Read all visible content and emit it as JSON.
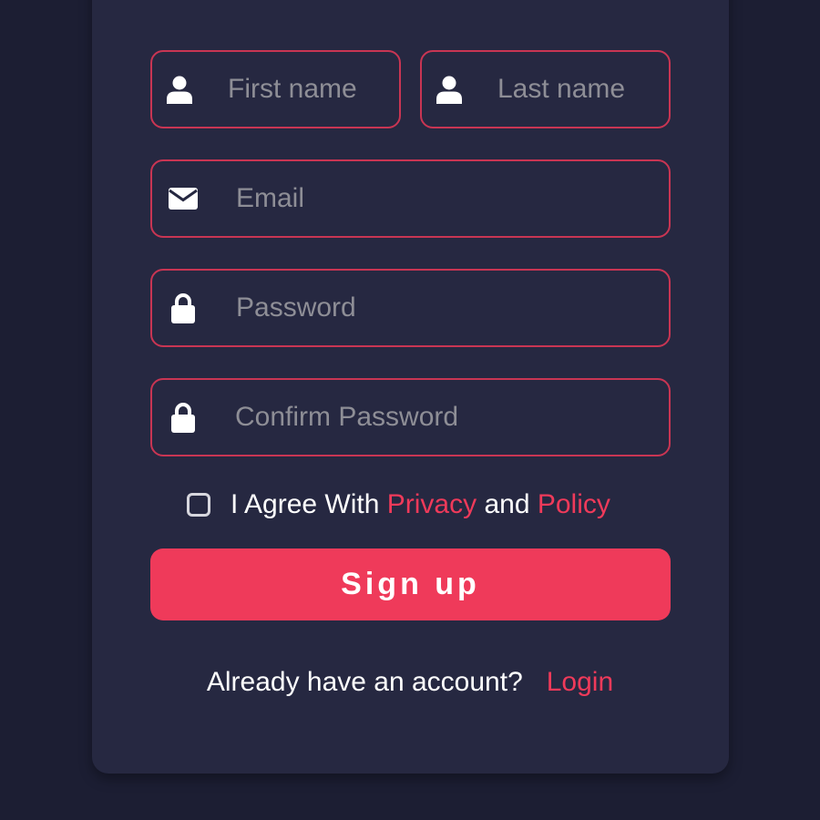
{
  "form": {
    "first_name": {
      "placeholder": "First name",
      "icon": "user-icon"
    },
    "last_name": {
      "placeholder": "Last name",
      "icon": "user-icon"
    },
    "email": {
      "placeholder": "Email",
      "icon": "envelope-icon"
    },
    "password": {
      "placeholder": "Password",
      "icon": "lock-icon"
    },
    "confirm_password": {
      "placeholder": "Confirm Password",
      "icon": "lock-icon"
    },
    "agree": {
      "checked": false,
      "prefix": "I Agree With",
      "privacy_link": "Privacy",
      "conjunction": "and",
      "policy_link": "Policy"
    },
    "submit_label": "Sign up"
  },
  "footer": {
    "prompt": "Already have an account?",
    "login_link": "Login"
  },
  "colors": {
    "background": "#1c1e33",
    "card": "#262841",
    "field_border": "#c93553",
    "accent": "#ef3a5a",
    "placeholder": "#8e8e96",
    "text": "#ffffff"
  }
}
